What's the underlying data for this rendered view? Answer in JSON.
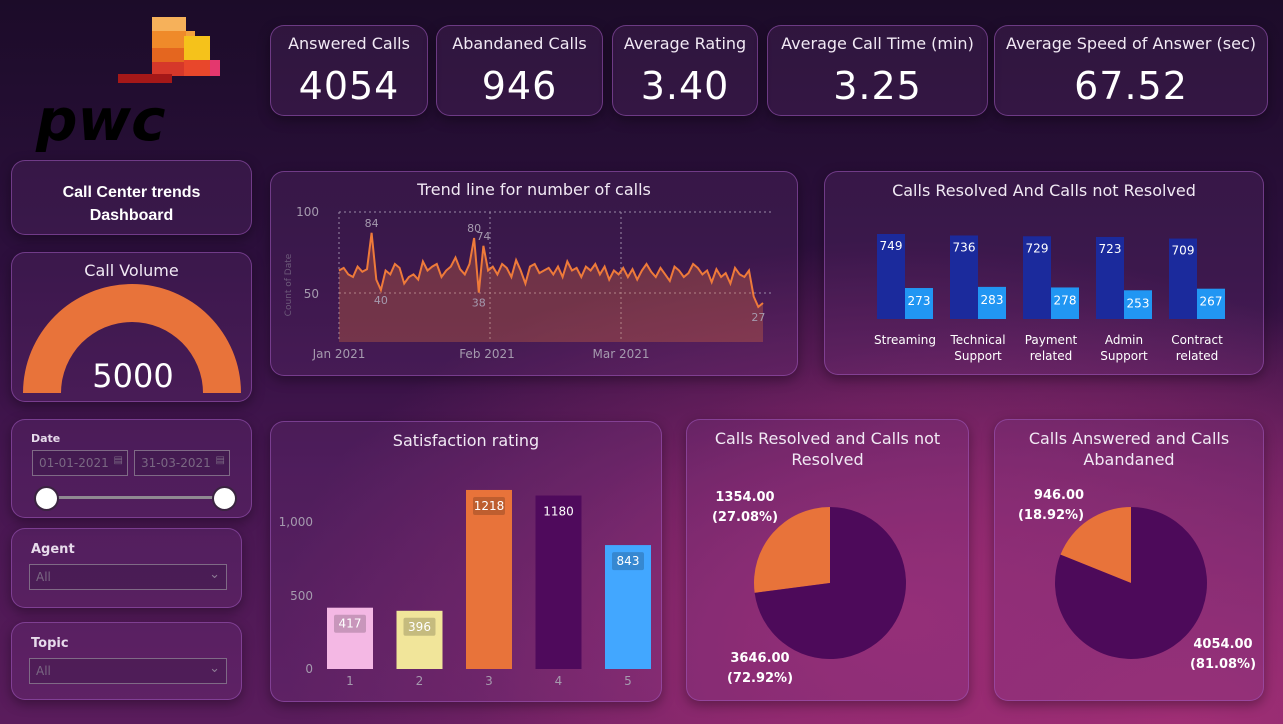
{
  "brand": {
    "logo_text": "pwc",
    "logo_colors": [
      "#f2a13b",
      "#e7661c",
      "#d4382b",
      "#c91e2c",
      "#f5c21b",
      "#e4376e"
    ]
  },
  "kpis": [
    {
      "title": "Answered Calls",
      "value": "4054"
    },
    {
      "title": "Abandaned Calls",
      "value": "946"
    },
    {
      "title": "Average Rating",
      "value": "3.40"
    },
    {
      "title": "Average Call Time (min)",
      "value": "3.25"
    },
    {
      "title": "Average Speed of Answer (sec)",
      "value": "67.52"
    }
  ],
  "dashboard_title": {
    "line1": "Call Center trends",
    "line2": "Dashboard"
  },
  "call_volume": {
    "title": "Call Volume",
    "value": "5000",
    "gauge_fraction": 1.0,
    "color": "#e8733a"
  },
  "date_slicer": {
    "label": "Date",
    "start": "01-01-2021",
    "end": "31-03-2021"
  },
  "agent_slicer": {
    "label": "Agent",
    "value": "All"
  },
  "topic_slicer": {
    "label": "Topic",
    "value": "All"
  },
  "trend": {
    "title": "Trend line for number of calls",
    "ylabel": "Count of Date",
    "yticks": [
      "100",
      "50"
    ],
    "xticks": [
      "Jan 2021",
      "Feb 2021",
      "Mar 2021"
    ],
    "annotations": [
      "84",
      "40",
      "80",
      "74",
      "38",
      "27"
    ]
  },
  "resolved_bars": {
    "title": "Calls Resolved And Calls not Resolved",
    "colors": {
      "resolved": "#1b2a9c",
      "not_resolved": "#2196f3"
    }
  },
  "satisfaction": {
    "title": "Satisfaction rating",
    "yticks": [
      "1,000",
      "500",
      "0"
    ]
  },
  "pie_resolved": {
    "title_line1": "Calls Resolved and Calls not",
    "title_line2": "Resolved",
    "label_small_value": "1354.00",
    "label_small_pct": "(27.08%)",
    "label_large_value": "3646.00",
    "label_large_pct": "(72.92%)"
  },
  "pie_answered": {
    "title_line1": "Calls Answered and Calls",
    "title_line2": "Abandaned",
    "label_small_value": "946.00",
    "label_small_pct": "(18.92%)",
    "label_large_value": "4054.00",
    "label_large_pct": "(81.08%)"
  },
  "chart_data": [
    {
      "type": "area",
      "title": "Trend line for number of calls",
      "xlabel": "",
      "ylabel": "Count of Date",
      "ylim": [
        0,
        100
      ],
      "x_start": "2021-01-01",
      "values": [
        55,
        57,
        52,
        50,
        58,
        54,
        56,
        84,
        48,
        40,
        55,
        52,
        60,
        57,
        45,
        50,
        52,
        48,
        62,
        55,
        58,
        60,
        50,
        55,
        58,
        65,
        56,
        52,
        60,
        80,
        38,
        74,
        55,
        58,
        52,
        60,
        57,
        50,
        63,
        55,
        45,
        58,
        60,
        53,
        55,
        57,
        52,
        58,
        50,
        62,
        55,
        57,
        50,
        58,
        55,
        60,
        52,
        58,
        48,
        55,
        52,
        57,
        50,
        56,
        48,
        55,
        60,
        54,
        50,
        57,
        52,
        47,
        58,
        55,
        50,
        53,
        60,
        57,
        52,
        55,
        46,
        56,
        50,
        53,
        45,
        57,
        52,
        50,
        55,
        35,
        27,
        30
      ],
      "annotated_points": [
        {
          "label": "84",
          "value": 84
        },
        {
          "label": "40",
          "value": 40
        },
        {
          "label": "80",
          "value": 80
        },
        {
          "label": "74",
          "value": 74
        },
        {
          "label": "38",
          "value": 38
        },
        {
          "label": "27",
          "value": 27
        }
      ]
    },
    {
      "type": "bar",
      "title": "Calls Resolved And Calls not Resolved",
      "categories": [
        "Streaming",
        "Technical Support",
        "Payment related",
        "Admin Support",
        "Contract related"
      ],
      "series": [
        {
          "values": [
            749,
            736,
            729,
            723,
            709
          ]
        },
        {
          "values": [
            273,
            283,
            278,
            253,
            267
          ]
        }
      ]
    },
    {
      "type": "bar",
      "title": "Satisfaction rating",
      "categories": [
        "1",
        "2",
        "3",
        "4",
        "5"
      ],
      "values": [
        417,
        396,
        1218,
        1180,
        843
      ],
      "colors": [
        "#f4b8e4",
        "#f1e59a",
        "#e8733a",
        "#4f0a5c",
        "#42a7ff"
      ],
      "ylim": [
        0,
        1250
      ]
    },
    {
      "type": "pie",
      "title": "Calls Resolved and Calls not Resolved",
      "slices": [
        {
          "value": 1354,
          "pct": 27.08,
          "color": "#e8733a"
        },
        {
          "value": 3646,
          "pct": 72.92,
          "color": "#4d0a5a"
        }
      ]
    },
    {
      "type": "pie",
      "title": "Calls Answered and Calls Abandaned",
      "slices": [
        {
          "value": 946,
          "pct": 18.92,
          "color": "#e8733a"
        },
        {
          "value": 4054,
          "pct": 81.08,
          "color": "#4d0a5a"
        }
      ]
    }
  ]
}
